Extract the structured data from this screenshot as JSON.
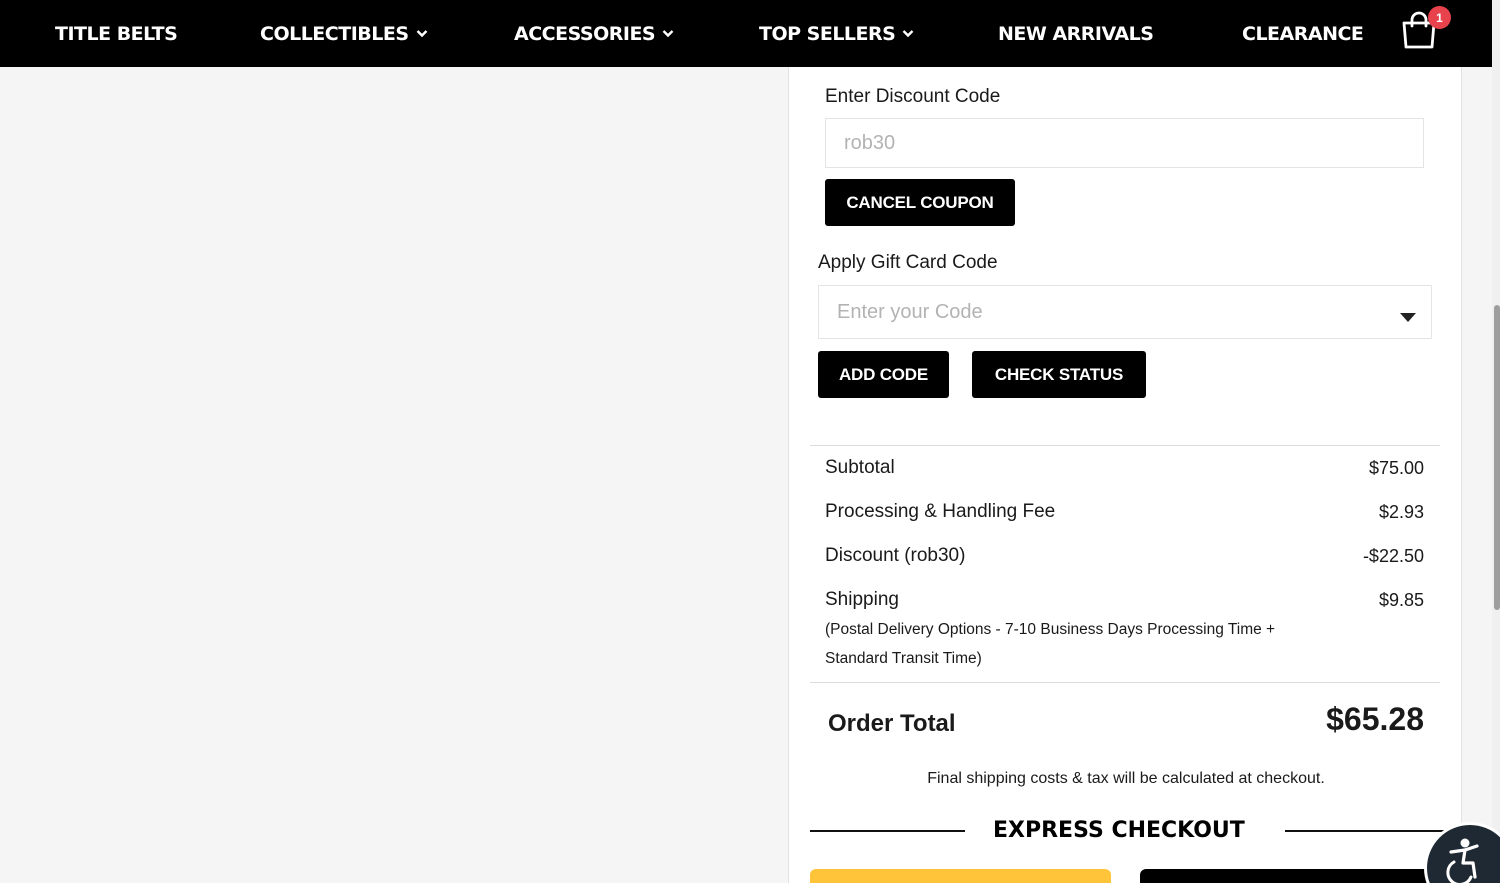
{
  "nav": {
    "items": [
      {
        "label": "TITLE BELTS",
        "dropdown": false
      },
      {
        "label": "COLLECTIBLES",
        "dropdown": true
      },
      {
        "label": "ACCESSORIES",
        "dropdown": true
      },
      {
        "label": "TOP SELLERS",
        "dropdown": true
      },
      {
        "label": "NEW ARRIVALS",
        "dropdown": false
      },
      {
        "label": "CLEARANCE",
        "dropdown": false
      }
    ],
    "cart_count": "1",
    "cart_icon": "shopping-bag-icon"
  },
  "discount": {
    "label": "Enter Discount Code",
    "value": "rob30",
    "cancel_label": "CANCEL COUPON"
  },
  "gift_card": {
    "label": "Apply Gift Card Code",
    "placeholder": "Enter your Code",
    "add_label": "ADD CODE",
    "check_label": "CHECK STATUS"
  },
  "summary": {
    "subtotal_label": "Subtotal",
    "subtotal_value": "$75.00",
    "fee_label": "Processing & Handling Fee",
    "fee_value": "$2.93",
    "discount_label": "Discount (rob30)",
    "discount_value": "-$22.50",
    "shipping_label": "Shipping",
    "shipping_value": "$9.85",
    "shipping_note": "(Postal Delivery Options - 7-10 Business Days Processing Time + Standard Transit Time)",
    "total_label": "Order Total",
    "total_value": "$65.28",
    "fine_print": "Final shipping costs & tax will be calculated at checkout."
  },
  "express_checkout": {
    "title": "EXPRESS CHECKOUT"
  },
  "colors": {
    "nav_bg": "#000000",
    "badge": "#e8434d",
    "paypal_yellow": "#ffc439",
    "accessibility_bg": "#1e2933"
  }
}
